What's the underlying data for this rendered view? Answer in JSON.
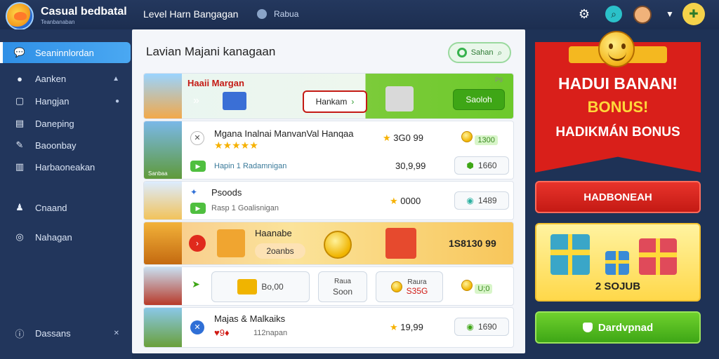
{
  "app": {
    "name": "Casual bedbatal",
    "subtitle": "Teanbanaban"
  },
  "topbar": {
    "title": "Level Harn Bangagan",
    "link": "Rabua"
  },
  "sidebar": {
    "items": [
      {
        "label": "Seaninnlordan",
        "icon": "chat-icon"
      },
      {
        "label": "Aanken",
        "icon": "user-icon"
      },
      {
        "label": "Hangjan",
        "icon": "square-icon"
      },
      {
        "label": "Daneping",
        "icon": "document-icon"
      },
      {
        "label": "Baoonbay",
        "icon": "pencil-icon"
      },
      {
        "label": "Harbaoneakan",
        "icon": "chart-icon"
      },
      {
        "label": "Cnaand",
        "icon": "group-icon"
      },
      {
        "label": "Nahagan",
        "icon": "circle-icon"
      },
      {
        "label": "Dassans",
        "icon": "info-icon"
      }
    ]
  },
  "main": {
    "title": "Lavian Majani kanagaan",
    "search_label": "Sahan",
    "banner": {
      "title": "Haaii Margan",
      "button": "Hankam",
      "action": "Saoloh",
      "corner": "P9"
    },
    "rows": [
      {
        "title": "Mgana Inalnai ManvanVal Hanqaa",
        "stars": "★★★★★",
        "sub": "Hapin 1 Radamnigan",
        "price": "3G0 99",
        "price2": "30,9,99",
        "coins": "1300",
        "btn": "1660",
        "caption": "Sanbaa"
      },
      {
        "title": "Psoods",
        "sub": "Rasp 1 Goalisnigan",
        "price": "0000",
        "btn": "1489"
      },
      {
        "title": "Haanabe",
        "sub": "2oanbs",
        "value": "1S8130 99"
      },
      {
        "left_label": "Bo,00",
        "mid_top": "Raua",
        "mid_bottom": "Soon",
        "right_top": "Raura",
        "right_bottom": "S35G",
        "tag": "U;0"
      },
      {
        "title": "Majas & Malkaiks",
        "sub": "112napan",
        "hearts": "♥9♦",
        "price": "19,99",
        "btn": "1690"
      }
    ]
  },
  "promo": {
    "line1": "HADUI BANAN!",
    "line2": "BONUS!",
    "line3": "HADIKMÁN BONUS",
    "red_button": "HADBONEAH",
    "gift_label": "2 SOJUB",
    "green_button": "Dardvpnad"
  },
  "colors": {
    "accent": "#2f8fe6",
    "red": "#d91f1a",
    "green": "#4fbf3f",
    "gold": "#f4b820"
  }
}
